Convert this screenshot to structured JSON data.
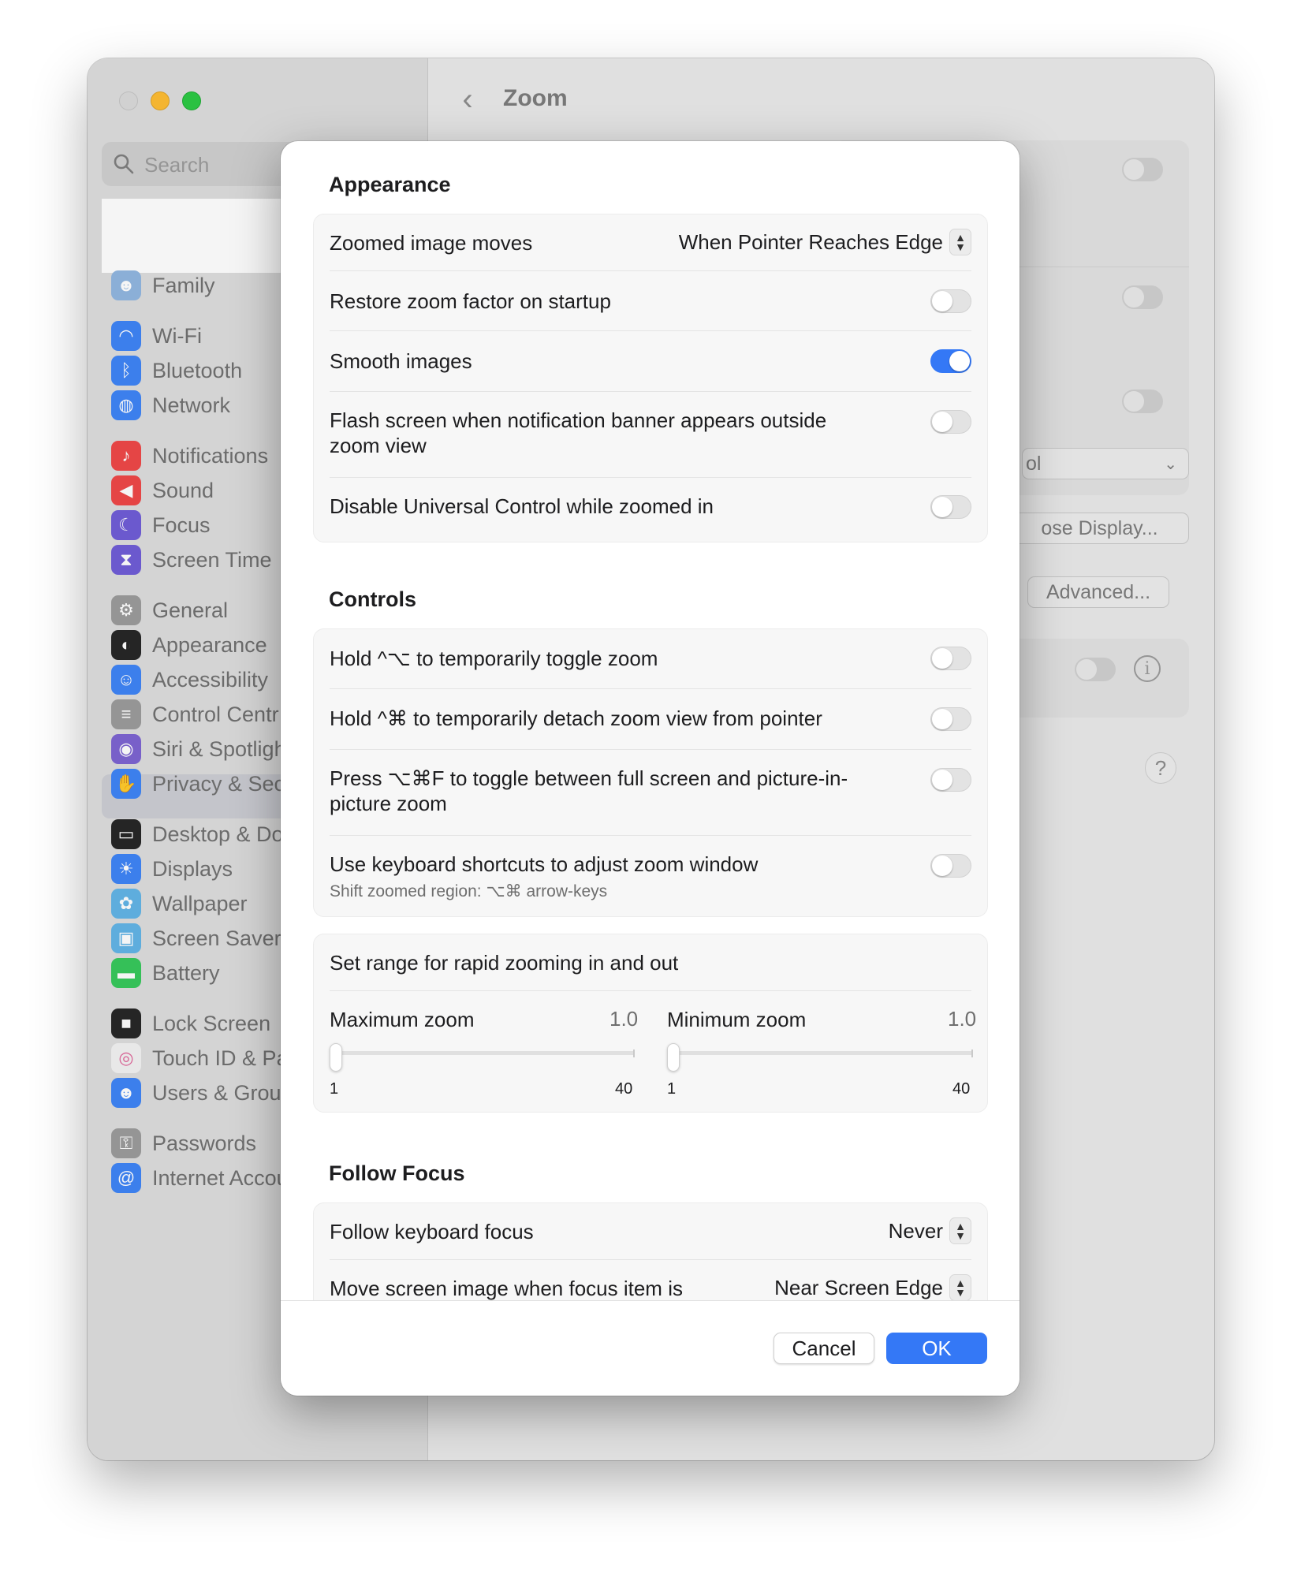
{
  "window": {
    "title": "Zoom",
    "search_placeholder": "Search"
  },
  "sidebar": {
    "items": [
      {
        "label": "Family",
        "icon": "family-icon",
        "color": "#8fb5e0"
      },
      {
        "label": "Wi-Fi",
        "icon": "wifi-icon",
        "color": "#3b82f6"
      },
      {
        "label": "Bluetooth",
        "icon": "bluetooth-icon",
        "color": "#3b82f6"
      },
      {
        "label": "Network",
        "icon": "globe-icon",
        "color": "#3b82f6"
      },
      {
        "label": "Notifications",
        "icon": "bell-icon",
        "color": "#ef4444"
      },
      {
        "label": "Sound",
        "icon": "speaker-icon",
        "color": "#ef4444"
      },
      {
        "label": "Focus",
        "icon": "moon-icon",
        "color": "#6d5ad6"
      },
      {
        "label": "Screen Time",
        "icon": "hourglass-icon",
        "color": "#6d5ad6"
      },
      {
        "label": "General",
        "icon": "gear-icon",
        "color": "#9a9a9a"
      },
      {
        "label": "Appearance",
        "icon": "appearance-icon",
        "color": "#222222"
      },
      {
        "label": "Accessibility",
        "icon": "accessibility-icon",
        "color": "#3b82f6"
      },
      {
        "label": "Control Centr",
        "icon": "control-center-icon",
        "color": "#9a9a9a"
      },
      {
        "label": "Siri & Spotligh",
        "icon": "siri-icon",
        "color": "#7b61d1"
      },
      {
        "label": "Privacy & Sec",
        "icon": "hand-icon",
        "color": "#3b82f6"
      },
      {
        "label": "Desktop & Do",
        "icon": "desktop-icon",
        "color": "#222222"
      },
      {
        "label": "Displays",
        "icon": "sun-icon",
        "color": "#3b82f6"
      },
      {
        "label": "Wallpaper",
        "icon": "flower-icon",
        "color": "#5fb3e6"
      },
      {
        "label": "Screen Saver",
        "icon": "screensaver-icon",
        "color": "#5fb3e6"
      },
      {
        "label": "Battery",
        "icon": "battery-icon",
        "color": "#34c759"
      },
      {
        "label": "Lock Screen",
        "icon": "lock-icon",
        "color": "#222222"
      },
      {
        "label": "Touch ID & Pa",
        "icon": "fingerprint-icon",
        "color": "#f2f2f2"
      },
      {
        "label": "Users & Grou",
        "icon": "users-icon",
        "color": "#3b82f6"
      },
      {
        "label": "Passwords",
        "icon": "key-icon",
        "color": "#9a9a9a"
      },
      {
        "label": "Internet Accounts",
        "icon": "at-icon",
        "color": "#3b82f6"
      }
    ]
  },
  "background_panel": {
    "choose_display_label": "ose Display...",
    "advanced_label": "Advanced...",
    "dropdown_fragment": "ol",
    "help_label": "?"
  },
  "sheet": {
    "appearance": {
      "title": "Appearance",
      "zoomed_image_moves": {
        "label": "Zoomed image moves",
        "value": "When Pointer Reaches Edge"
      },
      "restore_zoom": {
        "label": "Restore zoom factor on startup",
        "on": false
      },
      "smooth_images": {
        "label": "Smooth images",
        "on": true
      },
      "flash_screen": {
        "label": "Flash screen when notification banner appears outside zoom view",
        "on": false
      },
      "disable_universal": {
        "label": "Disable Universal Control while zoomed in",
        "on": false
      }
    },
    "controls": {
      "title": "Controls",
      "hold_toggle": {
        "label": "Hold ^⌥ to temporarily toggle zoom",
        "on": false
      },
      "hold_detach": {
        "label": "Hold ^⌘ to temporarily detach zoom view from pointer",
        "on": false
      },
      "press_toggle": {
        "label": "Press ⌥⌘F to toggle between full screen and picture-in-picture zoom",
        "on": false
      },
      "keyboard_shortcuts": {
        "label": "Use keyboard shortcuts to adjust zoom window",
        "sub": "Shift zoomed region: ⌥⌘ arrow-keys",
        "on": false
      }
    },
    "range": {
      "title": "Set range for rapid zooming in and out",
      "max": {
        "label": "Maximum zoom",
        "value": "1.0",
        "min_label": "1",
        "max_label": "40",
        "level": 1.0
      },
      "min": {
        "label": "Minimum zoom",
        "value": "1.0",
        "min_label": "1",
        "max_label": "40",
        "level": 1.0
      }
    },
    "follow_focus": {
      "title": "Follow Focus",
      "keyboard_focus": {
        "label": "Follow keyboard focus",
        "value": "Never"
      },
      "move_screen": {
        "label": "Move screen image when focus item is",
        "value": "Near Screen Edge"
      }
    },
    "buttons": {
      "cancel": "Cancel",
      "ok": "OK"
    }
  },
  "colors": {
    "accent": "#3478f6",
    "traffic_min": "#febc2e",
    "traffic_max": "#28c840"
  }
}
